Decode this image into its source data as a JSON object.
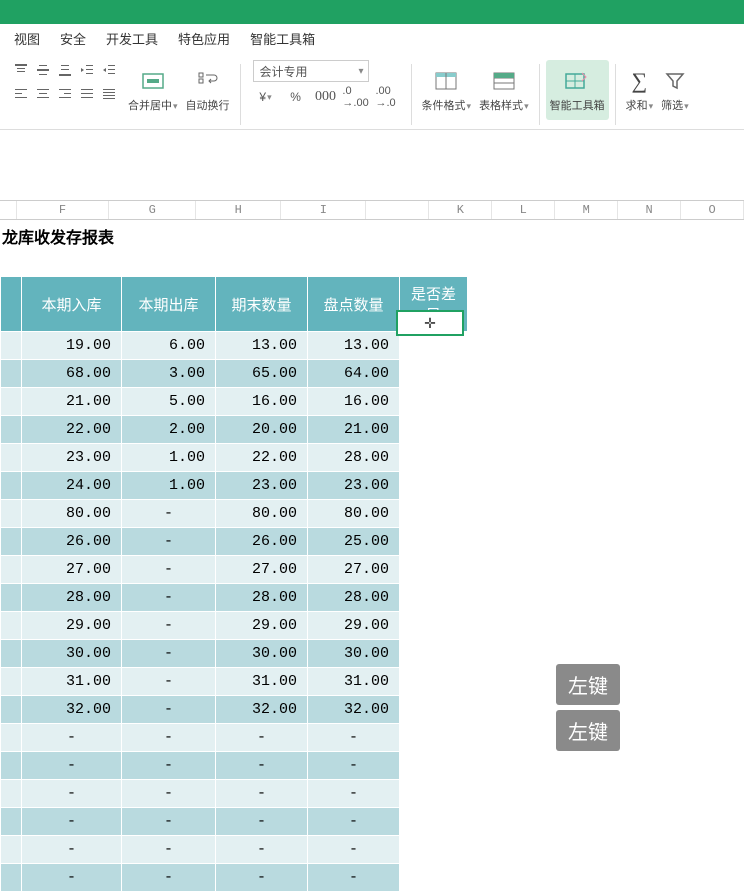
{
  "menu": [
    "视图",
    "安全",
    "开发工具",
    "特色应用",
    "智能工具箱"
  ],
  "ribbon": {
    "merge": "合并居中",
    "wrap": "自动换行",
    "number_format": "会计专用",
    "cond_format": "条件格式",
    "table_style": "表格样式",
    "smart_tool": "智能工具箱",
    "sum": "求和",
    "filter": "筛选"
  },
  "cols": {
    "F": "F",
    "G": "G",
    "H": "H",
    "I": "I",
    "K": "K",
    "L": "L",
    "M": "M",
    "N": "N",
    "O": "O"
  },
  "sheet": {
    "title": "龙库收发存报表",
    "headers": [
      "本期入库",
      "本期出库",
      "期末数量",
      "盘点数量",
      "是否差异"
    ],
    "rows": [
      [
        "19.00",
        "6.00",
        "13.00",
        "13.00"
      ],
      [
        "68.00",
        "3.00",
        "65.00",
        "64.00"
      ],
      [
        "21.00",
        "5.00",
        "16.00",
        "16.00"
      ],
      [
        "22.00",
        "2.00",
        "20.00",
        "21.00"
      ],
      [
        "23.00",
        "1.00",
        "22.00",
        "28.00"
      ],
      [
        "24.00",
        "1.00",
        "23.00",
        "23.00"
      ],
      [
        "80.00",
        "-",
        "80.00",
        "80.00"
      ],
      [
        "26.00",
        "-",
        "26.00",
        "25.00"
      ],
      [
        "27.00",
        "-",
        "27.00",
        "27.00"
      ],
      [
        "28.00",
        "-",
        "28.00",
        "28.00"
      ],
      [
        "29.00",
        "-",
        "29.00",
        "29.00"
      ],
      [
        "30.00",
        "-",
        "30.00",
        "30.00"
      ],
      [
        "31.00",
        "-",
        "31.00",
        "31.00"
      ],
      [
        "32.00",
        "-",
        "32.00",
        "32.00"
      ],
      [
        "-",
        "-",
        "-",
        "-"
      ],
      [
        "-",
        "-",
        "-",
        "-"
      ],
      [
        "-",
        "-",
        "-",
        "-"
      ],
      [
        "-",
        "-",
        "-",
        "-"
      ],
      [
        "-",
        "-",
        "-",
        "-"
      ],
      [
        "-",
        "-",
        "-",
        "-"
      ]
    ],
    "cursor": "✛"
  },
  "callouts": {
    "c1": "左键",
    "c2": "左键"
  }
}
